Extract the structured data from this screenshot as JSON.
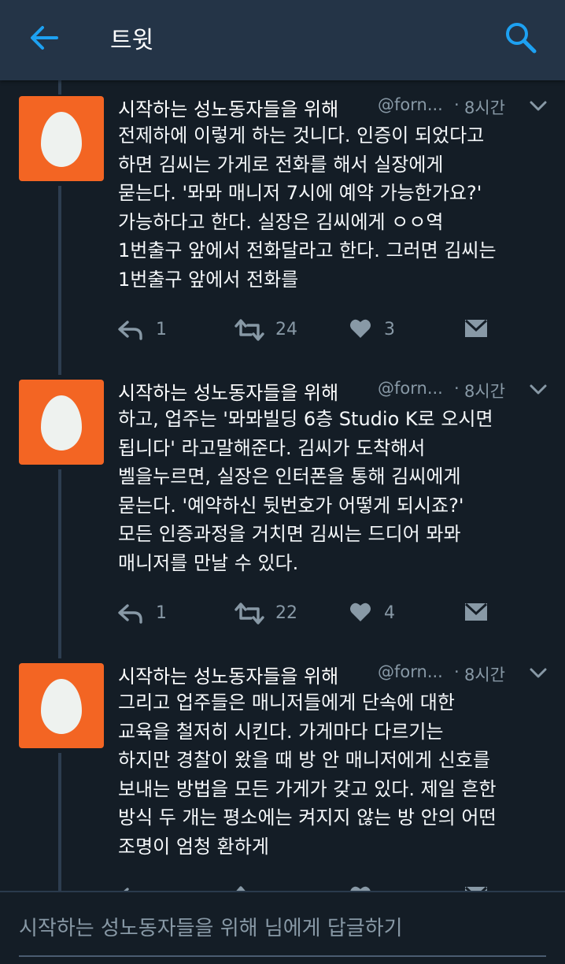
{
  "header": {
    "title": "트윗",
    "back_icon": "arrow-left-icon",
    "search_icon": "search-icon",
    "accent_color": "#1da1f2"
  },
  "tweets": [
    {
      "display_name": "시작하는 성노동자들을 위해",
      "handle": "@forn...",
      "dot": "·",
      "time": "8시간",
      "lines": [
        "전제하에 이렇게 하는 것니다. 인증이 되었다고",
        "하면 김씨는 가게로 전화를 해서 실장에게",
        "묻는다. '뫄뫄 매니저 7시에 예약 가능한가요?'",
        "가능하다고 한다. 실장은 김씨에게 ㅇㅇ역",
        "1번출구 앞에서 전화달라고 한다. 그러면 김씨는",
        "1번출구 앞에서 전화를"
      ],
      "reply_count": "1",
      "retweet_count": "24",
      "like_count": "3"
    },
    {
      "display_name": "시작하는 성노동자들을 위해",
      "handle": "@forn...",
      "dot": "·",
      "time": "8시간",
      "lines": [
        "하고, 업주는 '뫄뫄빌딩 6층 Studio K로 오시면",
        "됩니다' 라고말해준다. 김씨가 도착해서",
        "벨을누르면, 실장은 인터폰을 통해 김씨에게",
        "묻는다. '예약하신 뒷번호가 어떻게 되시죠?'",
        "모든 인증과정을 거치면 김씨는 드디어 뫄뫄",
        "매니저를 만날 수 있다."
      ],
      "reply_count": "1",
      "retweet_count": "22",
      "like_count": "4"
    },
    {
      "display_name": "시작하는 성노동자들을 위해",
      "handle": "@forn...",
      "dot": "·",
      "time": "8시간",
      "lines": [
        "그리고 업주들은 매니저들에게 단속에 대한",
        "교육을 철저히 시킨다. 가게마다 다르기는",
        "하지만 경찰이 왔을 때 방 안 매니저에게 신호를",
        "보내는 방법을 모든 가게가 갖고 있다. 제일 흔한",
        "방식 두 개는 평소에는 켜지지 않는 방 안의 어떤",
        "조명이 엄청 환하게"
      ]
    }
  ],
  "reply_bar": {
    "placeholder": "시작하는 성노동자들을 위해 님에게 답글하기"
  },
  "colors": {
    "background": "#141d26",
    "header": "#243447",
    "avatar": "#f36523",
    "muted": "#8899a6"
  }
}
